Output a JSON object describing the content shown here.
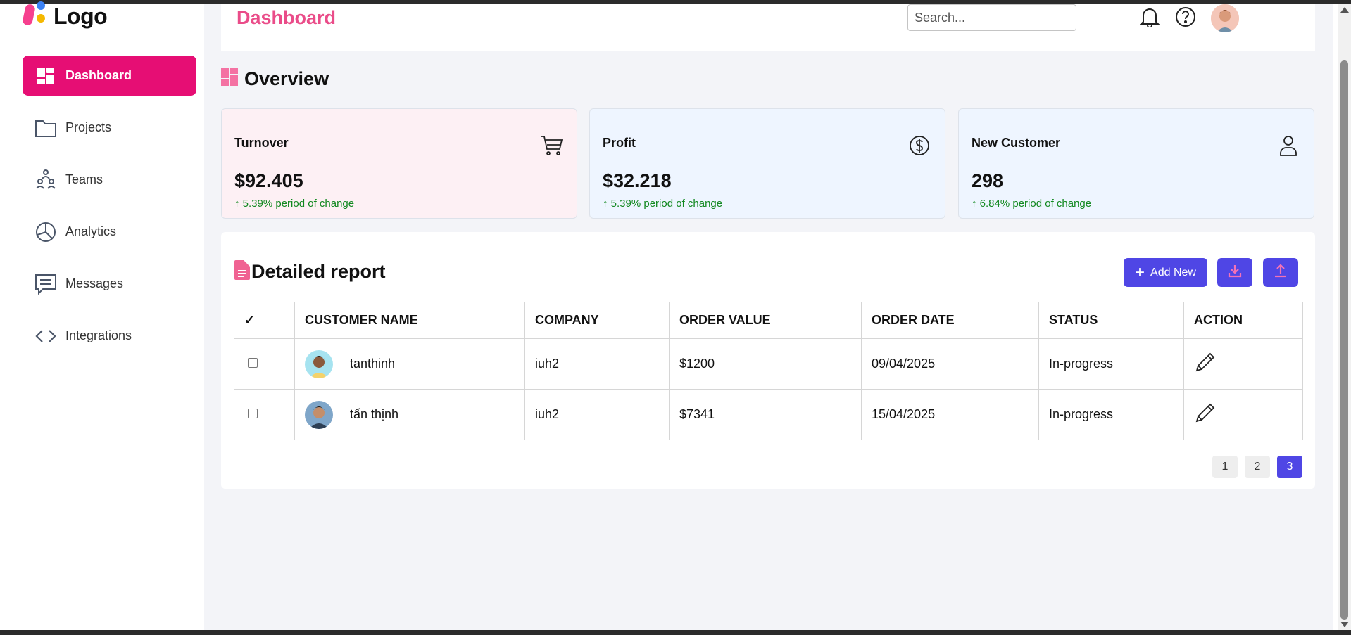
{
  "logo": {
    "text": "Logo"
  },
  "sidebar": {
    "items": [
      {
        "label": "Dashboard",
        "icon": "dashboard-icon",
        "active": true
      },
      {
        "label": "Projects",
        "icon": "folder-icon",
        "active": false
      },
      {
        "label": "Teams",
        "icon": "teams-icon",
        "active": false
      },
      {
        "label": "Analytics",
        "icon": "pie-chart-icon",
        "active": false
      },
      {
        "label": "Messages",
        "icon": "message-icon",
        "active": false
      },
      {
        "label": "Integrations",
        "icon": "code-icon",
        "active": false
      }
    ]
  },
  "header": {
    "title": "Dashboard",
    "search_placeholder": "Search...",
    "icons": [
      "bell-icon",
      "help-icon",
      "avatar"
    ]
  },
  "overview": {
    "title": "Overview",
    "cards": [
      {
        "title": "Turnover",
        "value": "$92.405",
        "change": "↑ 5.39% period of change",
        "icon": "cart-icon",
        "bg": "#fdf0f4"
      },
      {
        "title": "Profit",
        "value": "$32.218",
        "change": "↑ 5.39% period of change",
        "icon": "dollar-icon",
        "bg": "#eef5ff"
      },
      {
        "title": "New Customer",
        "value": "298",
        "change": "↑ 6.84% period of change",
        "icon": "user-icon",
        "bg": "#eef5ff"
      }
    ]
  },
  "report": {
    "title": "Detailed report",
    "add_label": "Add New",
    "columns": [
      "✓",
      "CUSTOMER NAME",
      "COMPANY",
      "ORDER VALUE",
      "ORDER DATE",
      "STATUS",
      "ACTION"
    ],
    "rows": [
      {
        "name": "tanthinh",
        "company": "iuh2",
        "value": "$1200",
        "date": "09/04/2025",
        "status": "In-progress"
      },
      {
        "name": "tấn thịnh",
        "company": "iuh2",
        "value": "$7341",
        "date": "15/04/2025",
        "status": "In-progress"
      }
    ],
    "pages": [
      "1",
      "2",
      "3"
    ],
    "active_page": "3"
  },
  "colors": {
    "accent": "#e60e74",
    "title_pink": "#ea4c89",
    "primary": "#4f46e5",
    "status": "#f0a500",
    "change_green": "#11881f"
  }
}
